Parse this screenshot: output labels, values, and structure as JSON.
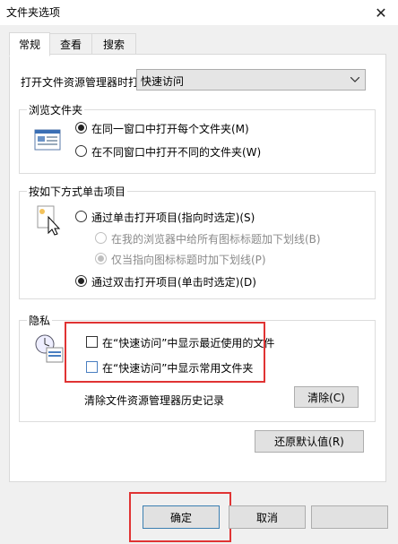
{
  "window": {
    "title": "文件夹选项",
    "close_glyph": "✕"
  },
  "tabs": [
    {
      "label": "常规"
    },
    {
      "label": "查看"
    },
    {
      "label": "搜索"
    }
  ],
  "open_to": {
    "label": "打开文件资源管理器时打",
    "value": "快速访问"
  },
  "browse": {
    "title": "浏览文件夹",
    "options": [
      {
        "label": "在同一窗口中打开每个文件夹(M)",
        "checked": true
      },
      {
        "label": "在不同窗口中打开不同的文件夹(W)",
        "checked": false
      }
    ]
  },
  "click": {
    "title": "按如下方式单击项目",
    "options": [
      {
        "label": "通过单击打开项目(指向时选定)(S)",
        "checked": false
      },
      {
        "label": "在我的浏览器中给所有图标标题加下划线(B)",
        "checked": false,
        "disabled": true
      },
      {
        "label": "仅当指向图标标题时加下划线(P)",
        "checked": true,
        "disabled": true
      },
      {
        "label": "通过双击打开项目(单击时选定)(D)",
        "checked": true
      }
    ]
  },
  "privacy": {
    "title": "隐私",
    "checkboxes": [
      {
        "label": "在“快速访问”中显示最近使用的文件",
        "checked": false
      },
      {
        "label": "在“快速访问”中显示常用文件夹",
        "checked": false
      }
    ],
    "clear_label": "清除文件资源管理器历史记录",
    "clear_button": "清除(C)"
  },
  "restore_button": "还原默认值(R)",
  "footer": {
    "ok": "确定",
    "cancel": "取消"
  },
  "colors": {
    "highlight": "#e03333",
    "page_bg": "#ffffff",
    "dialog_bg": "#f0f0f0"
  }
}
